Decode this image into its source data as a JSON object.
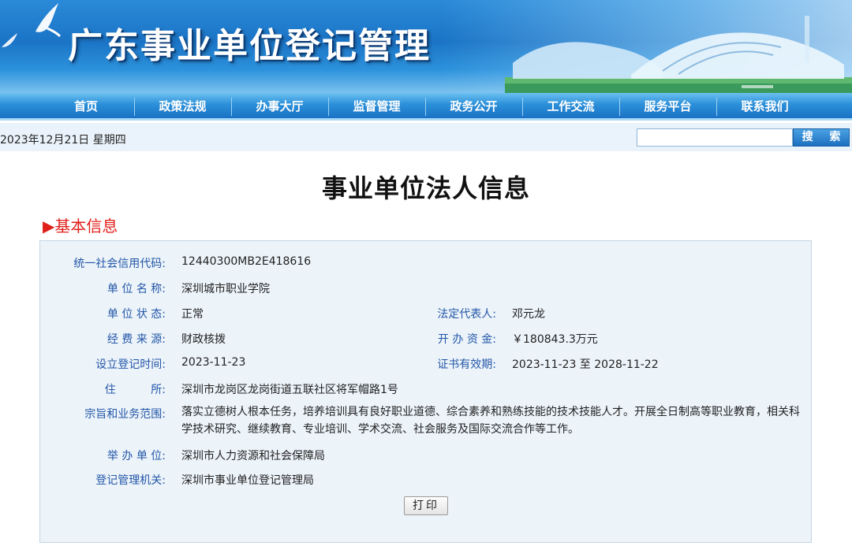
{
  "header": {
    "site_title": "广东事业单位登记管理"
  },
  "nav": {
    "items": [
      "首页",
      "政策法规",
      "办事大厅",
      "监督管理",
      "政务公开",
      "工作交流",
      "服务平台",
      "联系我们"
    ]
  },
  "datebar": {
    "date": "2023年12月21日 星期四",
    "search_placeholder": "",
    "search_button": "搜 索"
  },
  "page": {
    "title": "事业单位法人信息",
    "section_heading": "▶基本信息"
  },
  "info": {
    "credit_code_label": "统一社会信用代码:",
    "credit_code": "12440300MB2E418616",
    "name_label": "单 位 名 称:",
    "name": "深圳城市职业学院",
    "status_label": "单 位 状 态:",
    "status": "正常",
    "legal_rep_label": "法定代表人:",
    "legal_rep": "邓元龙",
    "funding_label": "经 费 来 源:",
    "funding": "财政核拨",
    "capital_label": "开 办 资 金:",
    "capital": "￥180843.3万元",
    "reg_date_label": "设立登记时间:",
    "reg_date": "2023-11-23",
    "validity_label": "证书有效期:",
    "validity": "2023-11-23 至 2028-11-22",
    "address_label": "住          所:",
    "address": "深圳市龙岗区龙岗街道五联社区将军帽路1号",
    "scope_label": "宗旨和业务范围:",
    "scope": "落实立德树人根本任务，培养培训具有良好职业道德、综合素养和熟练技能的技术技能人才。开展全日制高等职业教育，相关科学技术研究、继续教育、专业培训、学术交流、社会服务及国际交流合作等工作。",
    "sponsor_label": "举 办 单 位:",
    "sponsor": "深圳市人力资源和社会保障局",
    "authority_label": "登记管理机关:",
    "authority": "深圳市事业单位登记管理局",
    "print_button": "打印"
  },
  "colors": {
    "label_blue": "#2457a8",
    "section_red": "#e0201b",
    "panel_bg": "#ecf3f9",
    "nav_blue": "#1a72c4"
  }
}
